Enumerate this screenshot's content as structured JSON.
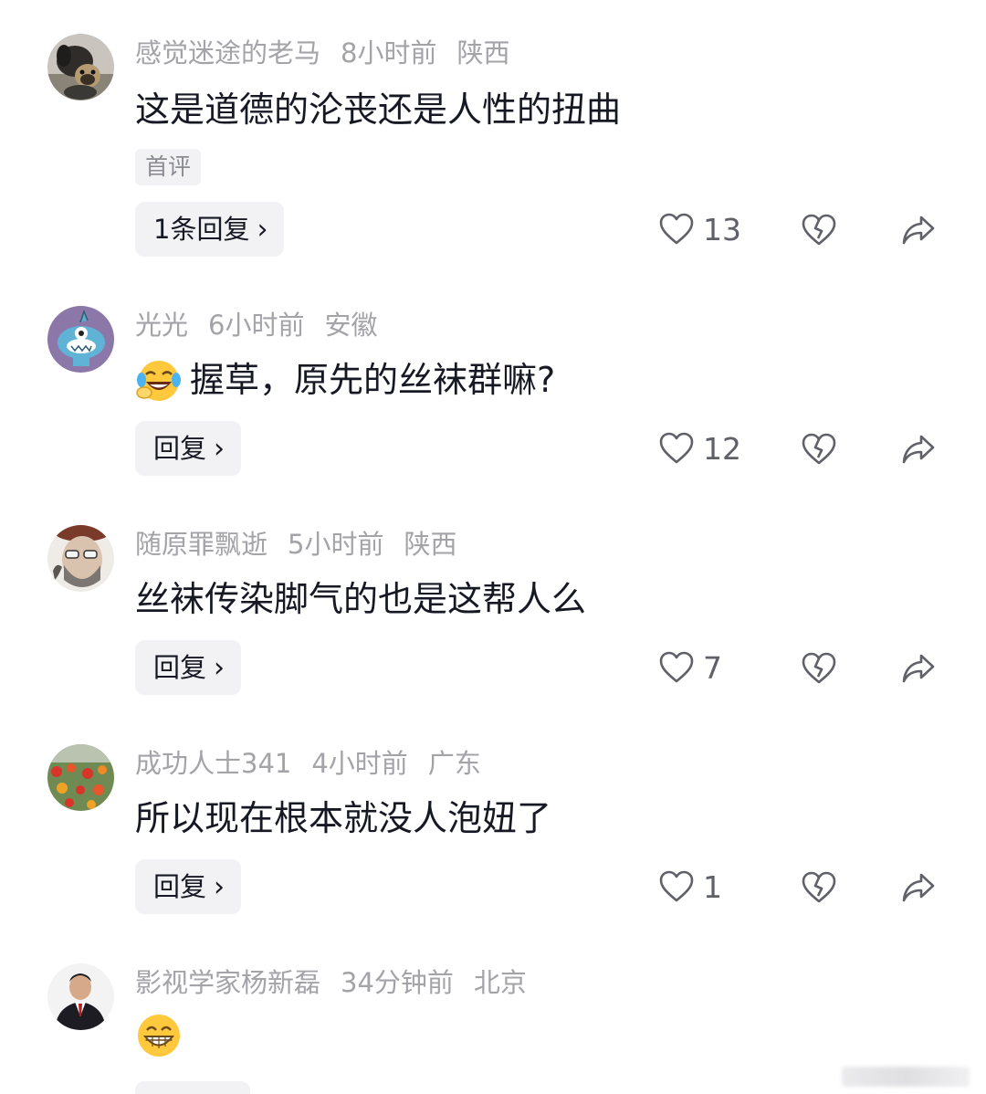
{
  "comments": [
    {
      "username": "感觉迷途的老马",
      "time": "8小时前",
      "location": "陕西",
      "text": "这是道德的沦丧还是人性的扭曲",
      "tag": "首评",
      "reply_label": "1条回复",
      "likes": "13",
      "avatar": "pug-dog-avatar"
    },
    {
      "username": "光光",
      "time": "6小时前",
      "location": "安徽",
      "text": "握草，原先的丝袜群嘛?",
      "emoji": "laughing-crying-emoji",
      "reply_label": "回复",
      "likes": "12",
      "avatar": "cartoon-monster-avatar"
    },
    {
      "username": "随原罪飘逝",
      "time": "5小时前",
      "location": "陕西",
      "text": "丝袜传染脚气的也是这帮人么",
      "reply_label": "回复",
      "likes": "7",
      "avatar": "bearded-man-avatar"
    },
    {
      "username": "成功人士341",
      "time": "4小时前",
      "location": "广东",
      "text": "所以现在根本就没人泡妞了",
      "reply_label": "回复",
      "likes": "1",
      "avatar": "flowers-avatar"
    },
    {
      "username": "影视学家杨新磊",
      "time": "34分钟前",
      "location": "北京",
      "emoji": "grinning-emoji",
      "avatar": "man-in-suit-avatar"
    }
  ],
  "icons": {
    "like": "heart-outline-icon",
    "dislike": "broken-heart-icon",
    "share": "share-arrow-icon",
    "chevron": "›"
  },
  "colors": {
    "text": "#161823",
    "meta": "#a3a3a8",
    "button_bg": "#f2f2f4",
    "icon": "#5f6068"
  }
}
